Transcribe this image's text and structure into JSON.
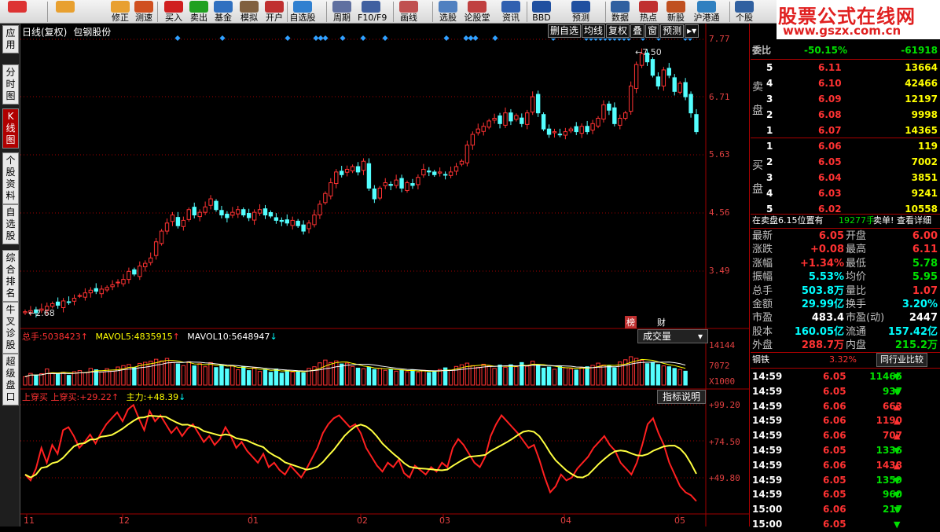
{
  "toolbar": {
    "items": [
      {
        "name": "rise-icon",
        "label": "",
        "color": "#d33"
      },
      {
        "name": "back-icon",
        "label": "",
        "color": "#e8a030"
      },
      {
        "name": "correct-button",
        "label": "修正",
        "color": "#e8a030"
      },
      {
        "name": "speed-test-button",
        "label": "测速",
        "color": "#d05020"
      },
      {
        "name": "buy-button",
        "label": "买入",
        "color": "#d02020"
      },
      {
        "name": "sell-button",
        "label": "卖出",
        "color": "#20a020"
      },
      {
        "name": "fund-button",
        "label": "基金",
        "color": "#3070c0"
      },
      {
        "name": "simulate-button",
        "label": "模拟",
        "color": "#806040"
      },
      {
        "name": "open-account-button",
        "label": "开户",
        "color": "#c03030"
      },
      {
        "name": "watchlist-button",
        "label": "自选股",
        "color": "#3080d0"
      },
      {
        "name": "period-button",
        "label": "周期",
        "color": "#6070a0"
      },
      {
        "name": "f10-button",
        "label": "F10/F9",
        "color": "#4060a0"
      },
      {
        "name": "draw-button",
        "label": "画线",
        "color": "#c05050"
      },
      {
        "name": "stock-picker-button",
        "label": "选股",
        "color": "#5080c0"
      },
      {
        "name": "forum-button",
        "label": "论股堂",
        "color": "#c04040"
      },
      {
        "name": "news-button",
        "label": "资讯",
        "color": "#3060b0"
      },
      {
        "name": "bbd-button",
        "label": "BBD",
        "color": "#2050a0"
      },
      {
        "name": "forecast-button",
        "label": "预测",
        "color": "#2050a0"
      },
      {
        "name": "data-button",
        "label": "数据",
        "color": "#3060a0"
      },
      {
        "name": "hot-button",
        "label": "热点",
        "color": "#c03030"
      },
      {
        "name": "new-stock-button",
        "label": "新股",
        "color": "#c05020"
      },
      {
        "name": "hk-connect-button",
        "label": "沪港通",
        "color": "#3080c0"
      },
      {
        "name": "personal-button",
        "label": "个股",
        "color": "#3060a0"
      }
    ]
  },
  "logo": {
    "line1": "股票公式在线网",
    "line2": "www.gszx.com.cn"
  },
  "left_tabs": [
    "应用",
    "分时图",
    "K线图",
    "个股资料",
    "自选股",
    "综合排名",
    "牛叉诊股",
    "超级盘口"
  ],
  "chart": {
    "title": "日线(复权)",
    "stock_name": "包钢股份",
    "buttons": [
      "删自选",
      "均线",
      "复权",
      "叠",
      "窗",
      "预测"
    ],
    "price_axis": [
      "7.77",
      "6.71",
      "5.63",
      "4.56",
      "3.49"
    ],
    "high_label": "7.50",
    "low_label": "2.68",
    "badges": [
      "榜",
      "财"
    ],
    "volume_header": {
      "total_label": "总手:",
      "total": "5038423",
      "mavol5_label": "MAVOL5:",
      "mavol5": "4835915",
      "mavol10_label": "MAVOL10:",
      "mavol10": "5648947"
    },
    "volume_select": "成交量",
    "volume_axis": [
      "14144",
      "7072",
      "X1000"
    ],
    "ind_header": {
      "name": "上穿买",
      "line1": "上穿买:",
      "val1": "+29.22",
      "line2": "主力:",
      "val2": "+48.39"
    },
    "ind_button": "指标说明",
    "ind_axis": [
      "+99.20",
      "+74.50",
      "+49.80"
    ],
    "x_axis": [
      "11",
      "12",
      "01",
      "02",
      "03",
      "04",
      "05"
    ]
  },
  "quote": {
    "weibi_label": "委比",
    "weibi": "-50.15%",
    "weicha": "-61918",
    "sell_side_label": [
      "卖",
      "盘"
    ],
    "buy_side_label": [
      "买",
      "盘"
    ],
    "sells": [
      {
        "lv": "5",
        "price": "6.11",
        "vol": "13664"
      },
      {
        "lv": "4",
        "price": "6.10",
        "vol": "42466"
      },
      {
        "lv": "3",
        "price": "6.09",
        "vol": "12197"
      },
      {
        "lv": "2",
        "price": "6.08",
        "vol": "9998"
      },
      {
        "lv": "1",
        "price": "6.07",
        "vol": "14365"
      }
    ],
    "buys": [
      {
        "lv": "1",
        "price": "6.06",
        "vol": "119"
      },
      {
        "lv": "2",
        "price": "6.05",
        "vol": "7002"
      },
      {
        "lv": "3",
        "price": "6.04",
        "vol": "3851"
      },
      {
        "lv": "4",
        "price": "6.03",
        "vol": "9241"
      },
      {
        "lv": "5",
        "price": "6.02",
        "vol": "10558"
      }
    ],
    "notice": {
      "text": "在卖盘6.15位置有",
      "num": "19277手",
      "tail": "卖单!",
      "link": "查看详细"
    },
    "stats": [
      {
        "l1": "最新",
        "v1": "6.05",
        "c1": "red",
        "l2": "开盘",
        "v2": "6.00",
        "c2": "red"
      },
      {
        "l1": "涨跌",
        "v1": "+0.08",
        "c1": "red",
        "l2": "最高",
        "v2": "6.11",
        "c2": "red"
      },
      {
        "l1": "涨幅",
        "v1": "+1.34%",
        "c1": "red",
        "l2": "最低",
        "v2": "5.78",
        "c2": "grn"
      },
      {
        "l1": "振幅",
        "v1": "5.53%",
        "c1": "cyan",
        "l2": "均价",
        "v2": "5.95",
        "c2": "grn"
      },
      {
        "l1": "总手",
        "v1": "503.8万",
        "c1": "cyan",
        "l2": "量比",
        "v2": "1.07",
        "c2": "red"
      },
      {
        "l1": "金额",
        "v1": "29.99亿",
        "c1": "cyan",
        "l2": "换手",
        "v2": "3.20%",
        "c2": "cyan"
      },
      {
        "l1": "市盈",
        "v1": "483.4",
        "c1": "wht",
        "l2": "市盈(动)",
        "v2": "2447",
        "c2": "wht"
      },
      {
        "l1": "股本",
        "v1": "160.05亿",
        "c1": "cyan",
        "l2": "流通",
        "v2": "157.42亿",
        "c2": "cyan"
      },
      {
        "l1": "外盘",
        "v1": "288.7万",
        "c1": "red",
        "l2": "内盘",
        "v2": "215.2万",
        "c2": "grn"
      }
    ],
    "sector": {
      "name": "钢铁",
      "change": "3.32%",
      "button": "同行业比较"
    },
    "ticks": [
      {
        "t": "14:59",
        "p": "6.05",
        "v": "11465",
        "d": "dn"
      },
      {
        "t": "14:59",
        "p": "6.05",
        "v": "937",
        "d": "dn"
      },
      {
        "t": "14:59",
        "p": "6.06",
        "v": "663",
        "d": "up"
      },
      {
        "t": "14:59",
        "p": "6.06",
        "v": "1190",
        "d": "up"
      },
      {
        "t": "14:59",
        "p": "6.06",
        "v": "707",
        "d": "up"
      },
      {
        "t": "14:59",
        "p": "6.05",
        "v": "1336",
        "d": "dn"
      },
      {
        "t": "14:59",
        "p": "6.06",
        "v": "1438",
        "d": "up"
      },
      {
        "t": "14:59",
        "p": "6.05",
        "v": "1359",
        "d": "dn"
      },
      {
        "t": "14:59",
        "p": "6.05",
        "v": "960",
        "d": "dn"
      },
      {
        "t": "15:00",
        "p": "6.06",
        "v": "217",
        "d": "dn"
      },
      {
        "t": "15:00",
        "p": "6.05",
        "v": "",
        "d": "dn"
      }
    ]
  },
  "colors": {
    "up": "#ff3232",
    "down": "#54ffff",
    "ma": "#ffffff",
    "ma2": "#ffff00",
    "grid": "#a00000"
  },
  "chart_data": {
    "type": "candlestick",
    "price_range": [
      2.68,
      7.77
    ],
    "closes": [
      2.7,
      2.72,
      2.68,
      2.75,
      2.8,
      2.85,
      2.82,
      2.9,
      2.88,
      2.95,
      3.0,
      3.05,
      3.1,
      3.08,
      3.12,
      3.15,
      3.2,
      3.25,
      3.3,
      3.45,
      3.4,
      3.55,
      3.6,
      3.7,
      4.0,
      4.2,
      4.35,
      4.5,
      4.3,
      4.4,
      4.6,
      4.5,
      4.55,
      4.65,
      4.8,
      4.6,
      4.5,
      4.45,
      4.55,
      4.6,
      4.5,
      4.45,
      4.55,
      4.6,
      4.5,
      4.48,
      4.4,
      4.38,
      4.35,
      4.4,
      4.3,
      4.2,
      4.35,
      4.5,
      4.7,
      4.9,
      5.1,
      5.3,
      5.25,
      5.35,
      5.4,
      5.3,
      5.5,
      5.0,
      4.8,
      5.0,
      5.1,
      5.05,
      5.15,
      5.0,
      5.1,
      5.05,
      5.2,
      5.35,
      5.3,
      5.25,
      5.3,
      5.25,
      5.3,
      5.4,
      5.5,
      5.8,
      6.0,
      6.1,
      6.15,
      6.25,
      6.3,
      6.2,
      6.4,
      6.25,
      6.35,
      6.2,
      6.4,
      6.7,
      6.4,
      6.1,
      6.0,
      6.05,
      6.0,
      6.05,
      6.1,
      6.05,
      6.15,
      6.05,
      6.2,
      6.3,
      6.55,
      6.45,
      6.2,
      6.3,
      6.4,
      6.9,
      7.3,
      7.5,
      7.35,
      7.1,
      6.9,
      7.2,
      7.1,
      6.8,
      6.95,
      6.7,
      6.4,
      6.05
    ],
    "volume": [
      3.0,
      4.2,
      3.6,
      4.1,
      5.8,
      4.4,
      3.9,
      4.6,
      3.5,
      4.8,
      5.2,
      4.4,
      6.0,
      5.5,
      4.7,
      5.9,
      5.0,
      6.5,
      7.0,
      7.4,
      6.3,
      7.8,
      8.2,
      8.6,
      9.3,
      8.7,
      9.6,
      8.2,
      7.6,
      7.0,
      8.4,
      6.9,
      7.7,
      6.6,
      8.1,
      6.3,
      7.3,
      5.8,
      6.9,
      5.5,
      6.6,
      5.2,
      6.2,
      4.9,
      5.6,
      4.6,
      5.8,
      4.3,
      5.3,
      4.7,
      5.0,
      4.4,
      6.0,
      6.6,
      8.0,
      9.0,
      8.1,
      8.7,
      7.6,
      7.9,
      6.7,
      6.1,
      5.9,
      6.5,
      5.6,
      6.0,
      5.3,
      5.7,
      5.0,
      5.4,
      4.8,
      5.5,
      4.6,
      5.3,
      4.5,
      5.1,
      5.6,
      6.2,
      5.4,
      6.7,
      7.3,
      7.9,
      7.0,
      6.4,
      7.5,
      6.8,
      6.0,
      7.2,
      6.4,
      7.3,
      6.6,
      8.1,
      6.8,
      8.6,
      7.2,
      6.1,
      6.5,
      5.7,
      6.8,
      6.2,
      5.8,
      5.4,
      6.3,
      6.6,
      7.1,
      7.9,
      7.2,
      6.9,
      6.2,
      8.3,
      9.1,
      10.2,
      9.6,
      8.9,
      7.7,
      8.2,
      7.4,
      6.9,
      6.6,
      6.0,
      5.6,
      5.0
    ],
    "indicator_range": [
      49.8,
      99.2
    ],
    "indicator_red": [
      52,
      48,
      56,
      70,
      60,
      72,
      66,
      82,
      84,
      78,
      70,
      74,
      79,
      73,
      80,
      86,
      90,
      94,
      88,
      96,
      99,
      90,
      82,
      95,
      88,
      92,
      86,
      80,
      84,
      78,
      83,
      86,
      80,
      74,
      78,
      72,
      76,
      84,
      78,
      70,
      74,
      68,
      64,
      60,
      66,
      57,
      60,
      55,
      52,
      58,
      54,
      50,
      56,
      63,
      70,
      80,
      86,
      90,
      92,
      88,
      84,
      86,
      80,
      70,
      64,
      58,
      54,
      60,
      57,
      62,
      53,
      50,
      58,
      55,
      52,
      57,
      54,
      60,
      57,
      70,
      76,
      72,
      66,
      60,
      57,
      64,
      78,
      86,
      92,
      88,
      84,
      80,
      75,
      70,
      72,
      62,
      50,
      40,
      44,
      52,
      48,
      50,
      56,
      60,
      64,
      70,
      74,
      78,
      72,
      68,
      60,
      56,
      52,
      60,
      72,
      86,
      90,
      80,
      72,
      60,
      52,
      44,
      40,
      38,
      34
    ]
  }
}
